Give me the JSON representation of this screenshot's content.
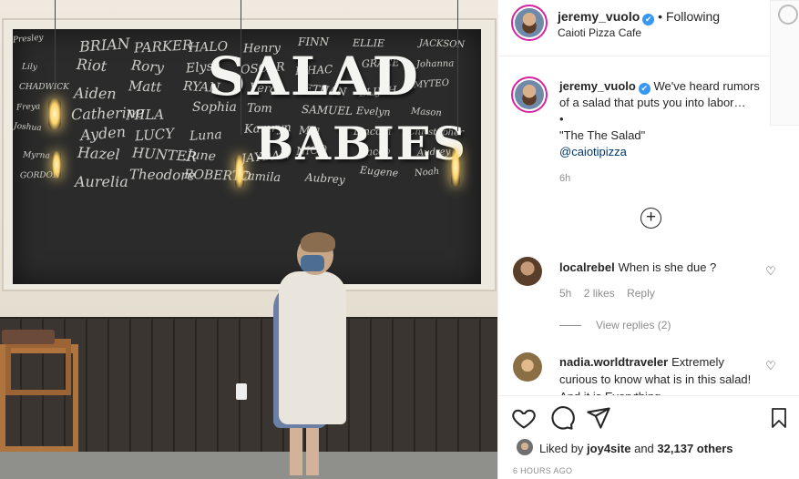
{
  "post_image": {
    "sign_line_1": "SALAD",
    "sign_line_2": "BABIES",
    "chalk_names": [
      "Presley",
      "BRIAN",
      "PARKER",
      "HALO",
      "Henry",
      "FINN",
      "ELLIE",
      "JACKSON",
      "Lily",
      "Riot",
      "Rory",
      "Elyse",
      "OSCAR",
      "ISHAC",
      "GRACE",
      "Johanna",
      "CHADWICK",
      "Aiden",
      "Matt",
      "RYAN",
      "Vera",
      "ETHAN",
      "ELIJAH",
      "MYTEO",
      "Freya",
      "Catherine",
      "MILA",
      "Sophia",
      "Tom",
      "SAMUEL",
      "Evelyn",
      "Mason",
      "Joshua",
      "Ayden",
      "LUCY",
      "Luna",
      "Kamryn",
      "Mia",
      "Lincoln",
      "Christopher",
      "Myrna",
      "Hazel",
      "HUNTER",
      "June",
      "JAYDAN",
      "NICO",
      "Jacob",
      "Audrey",
      "GORDON",
      "Aurelia",
      "Theodore",
      "ROBERTO",
      "Camila",
      "Aubrey",
      "Eugene",
      "Noah"
    ]
  },
  "header": {
    "username": "jeremy_vuolo",
    "verified_mark": "✔",
    "separator": "•",
    "follow_status": "Following",
    "location": "Caioti Pizza Cafe",
    "more_icon": "⋯"
  },
  "caption": {
    "username": "jeremy_vuolo",
    "text": "We've heard rumors of a salad that puts you into labor…",
    "bullet": "•",
    "quote": "\"The The Salad\"",
    "mention": "@caiotipizza",
    "time": "6h",
    "load_more_icon": "+"
  },
  "comments": [
    {
      "username": "localrebel",
      "text": "When is she due ?",
      "time": "5h",
      "likes": "2 likes",
      "reply": "Reply",
      "view_replies": "View replies (2)"
    },
    {
      "username": "nadia.worldtraveler",
      "text": "Extremely curious to know what is in this salad! And it is Everything..."
    }
  ],
  "actions": {
    "liked_prefix": "Liked by",
    "liked_user": "joy4site",
    "liked_and": "and",
    "liked_count": "32,137 others",
    "time_ago": "6 HOURS AGO"
  }
}
